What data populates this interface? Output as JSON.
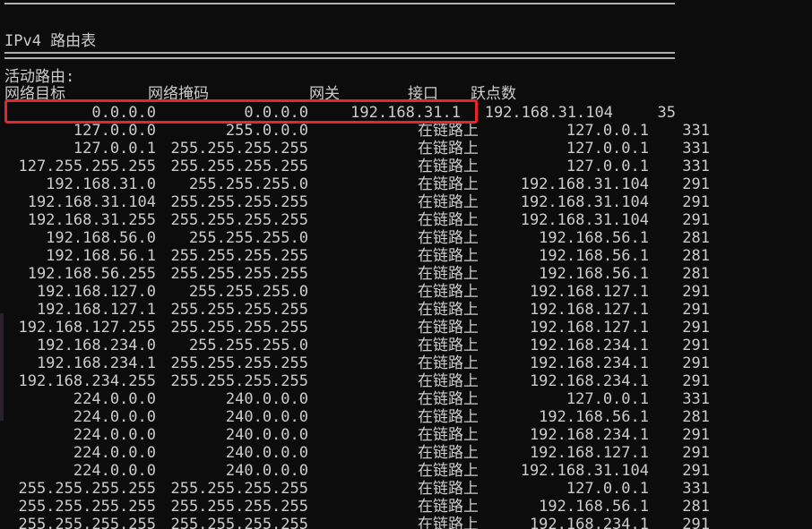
{
  "console": {
    "heading": "IPv4 路由表",
    "active_routes_label": "活动路由:",
    "columns": {
      "destination": "网络目标",
      "netmask": "网络掩码",
      "gateway": "网关",
      "interface": "接口",
      "metric": "跃点数"
    },
    "rows": [
      {
        "destination": "0.0.0.0",
        "netmask": "0.0.0.0",
        "gateway": "192.168.31.1",
        "interface": "192.168.31.104",
        "metric": "35"
      },
      {
        "destination": "127.0.0.0",
        "netmask": "255.0.0.0",
        "gateway": "在链路上",
        "interface": "127.0.0.1",
        "metric": "331"
      },
      {
        "destination": "127.0.0.1",
        "netmask": "255.255.255.255",
        "gateway": "在链路上",
        "interface": "127.0.0.1",
        "metric": "331"
      },
      {
        "destination": "127.255.255.255",
        "netmask": "255.255.255.255",
        "gateway": "在链路上",
        "interface": "127.0.0.1",
        "metric": "331"
      },
      {
        "destination": "192.168.31.0",
        "netmask": "255.255.255.0",
        "gateway": "在链路上",
        "interface": "192.168.31.104",
        "metric": "291"
      },
      {
        "destination": "192.168.31.104",
        "netmask": "255.255.255.255",
        "gateway": "在链路上",
        "interface": "192.168.31.104",
        "metric": "291"
      },
      {
        "destination": "192.168.31.255",
        "netmask": "255.255.255.255",
        "gateway": "在链路上",
        "interface": "192.168.31.104",
        "metric": "291"
      },
      {
        "destination": "192.168.56.0",
        "netmask": "255.255.255.0",
        "gateway": "在链路上",
        "interface": "192.168.56.1",
        "metric": "281"
      },
      {
        "destination": "192.168.56.1",
        "netmask": "255.255.255.255",
        "gateway": "在链路上",
        "interface": "192.168.56.1",
        "metric": "281"
      },
      {
        "destination": "192.168.56.255",
        "netmask": "255.255.255.255",
        "gateway": "在链路上",
        "interface": "192.168.56.1",
        "metric": "281"
      },
      {
        "destination": "192.168.127.0",
        "netmask": "255.255.255.0",
        "gateway": "在链路上",
        "interface": "192.168.127.1",
        "metric": "291"
      },
      {
        "destination": "192.168.127.1",
        "netmask": "255.255.255.255",
        "gateway": "在链路上",
        "interface": "192.168.127.1",
        "metric": "291"
      },
      {
        "destination": "192.168.127.255",
        "netmask": "255.255.255.255",
        "gateway": "在链路上",
        "interface": "192.168.127.1",
        "metric": "291"
      },
      {
        "destination": "192.168.234.0",
        "netmask": "255.255.255.0",
        "gateway": "在链路上",
        "interface": "192.168.234.1",
        "metric": "291"
      },
      {
        "destination": "192.168.234.1",
        "netmask": "255.255.255.255",
        "gateway": "在链路上",
        "interface": "192.168.234.1",
        "metric": "291"
      },
      {
        "destination": "192.168.234.255",
        "netmask": "255.255.255.255",
        "gateway": "在链路上",
        "interface": "192.168.234.1",
        "metric": "291"
      },
      {
        "destination": "224.0.0.0",
        "netmask": "240.0.0.0",
        "gateway": "在链路上",
        "interface": "127.0.0.1",
        "metric": "331"
      },
      {
        "destination": "224.0.0.0",
        "netmask": "240.0.0.0",
        "gateway": "在链路上",
        "interface": "192.168.56.1",
        "metric": "281"
      },
      {
        "destination": "224.0.0.0",
        "netmask": "240.0.0.0",
        "gateway": "在链路上",
        "interface": "192.168.234.1",
        "metric": "291"
      },
      {
        "destination": "224.0.0.0",
        "netmask": "240.0.0.0",
        "gateway": "在链路上",
        "interface": "192.168.127.1",
        "metric": "291"
      },
      {
        "destination": "224.0.0.0",
        "netmask": "240.0.0.0",
        "gateway": "在链路上",
        "interface": "192.168.31.104",
        "metric": "291"
      },
      {
        "destination": "255.255.255.255",
        "netmask": "255.255.255.255",
        "gateway": "在链路上",
        "interface": "127.0.0.1",
        "metric": "331"
      },
      {
        "destination": "255.255.255.255",
        "netmask": "255.255.255.255",
        "gateway": "在链路上",
        "interface": "192.168.56.1",
        "metric": "281"
      },
      {
        "destination": "255.255.255.255",
        "netmask": "255.255.255.255",
        "gateway": "在链路上",
        "interface": "192.168.234.1",
        "metric": "291"
      }
    ]
  },
  "colors": {
    "background": "#0c0c0c",
    "text": "#cccccc",
    "highlight_border": "#e8262a"
  }
}
